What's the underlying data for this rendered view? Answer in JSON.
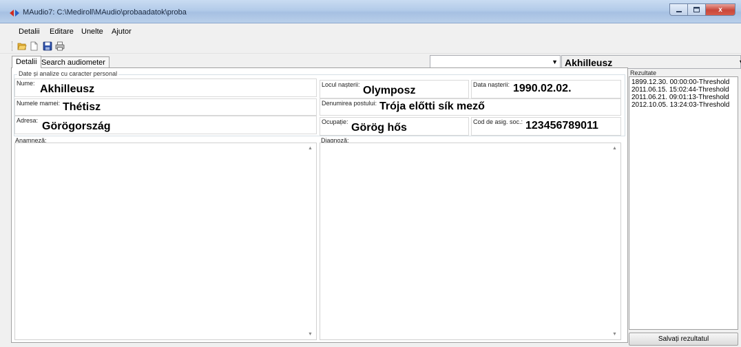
{
  "window": {
    "title": "MAudio7: C:\\Mediroll\\MAudio\\probaadatok\\proba",
    "close_glyph": "x"
  },
  "menu": [
    "Detalii",
    "Editare",
    "Unelte",
    "Ajutor"
  ],
  "toolbar": {
    "icons": [
      "open-folder-icon",
      "new-document-icon",
      "save-icon",
      "print-icon"
    ]
  },
  "tabs": [
    "Detalii",
    "Search audiometer"
  ],
  "patient_selector": {
    "selected": "Akhilleusz"
  },
  "personal": {
    "group_title": "Date și analize cu caracter personal",
    "name_label": "Nume:",
    "name": "Akhilleusz",
    "birthplace_label": "Locul nașterii:",
    "birthplace": "Olymposz",
    "birthdate_label": "Data nașterii:",
    "birthdate": "1990.02.02.",
    "mother_label": "Numele mamei:",
    "mother": "Thétisz",
    "workplace_label": "Denumirea postului:",
    "workplace": "Trója előtti sík mező",
    "address_label": "Adresa:",
    "address": "Görögország",
    "occupation_label": "Ocupație:",
    "occupation": "Görög hős",
    "insurance_label": "Cod de asig. soc.:",
    "insurance": "123456789011"
  },
  "anamnesis_label": "Anamneză:",
  "diagnosis_label": "Diagnoză:",
  "results": {
    "title": "Rezultate",
    "items": [
      "1899.12.30. 00:00:00-Threshold",
      "2011.06.15. 15:02:44-Threshold",
      "2011.06.21. 09:01:13-Threshold",
      "2012.10.05. 13:24:03-Threshold"
    ],
    "save_label": "Salvați rezultatul"
  }
}
